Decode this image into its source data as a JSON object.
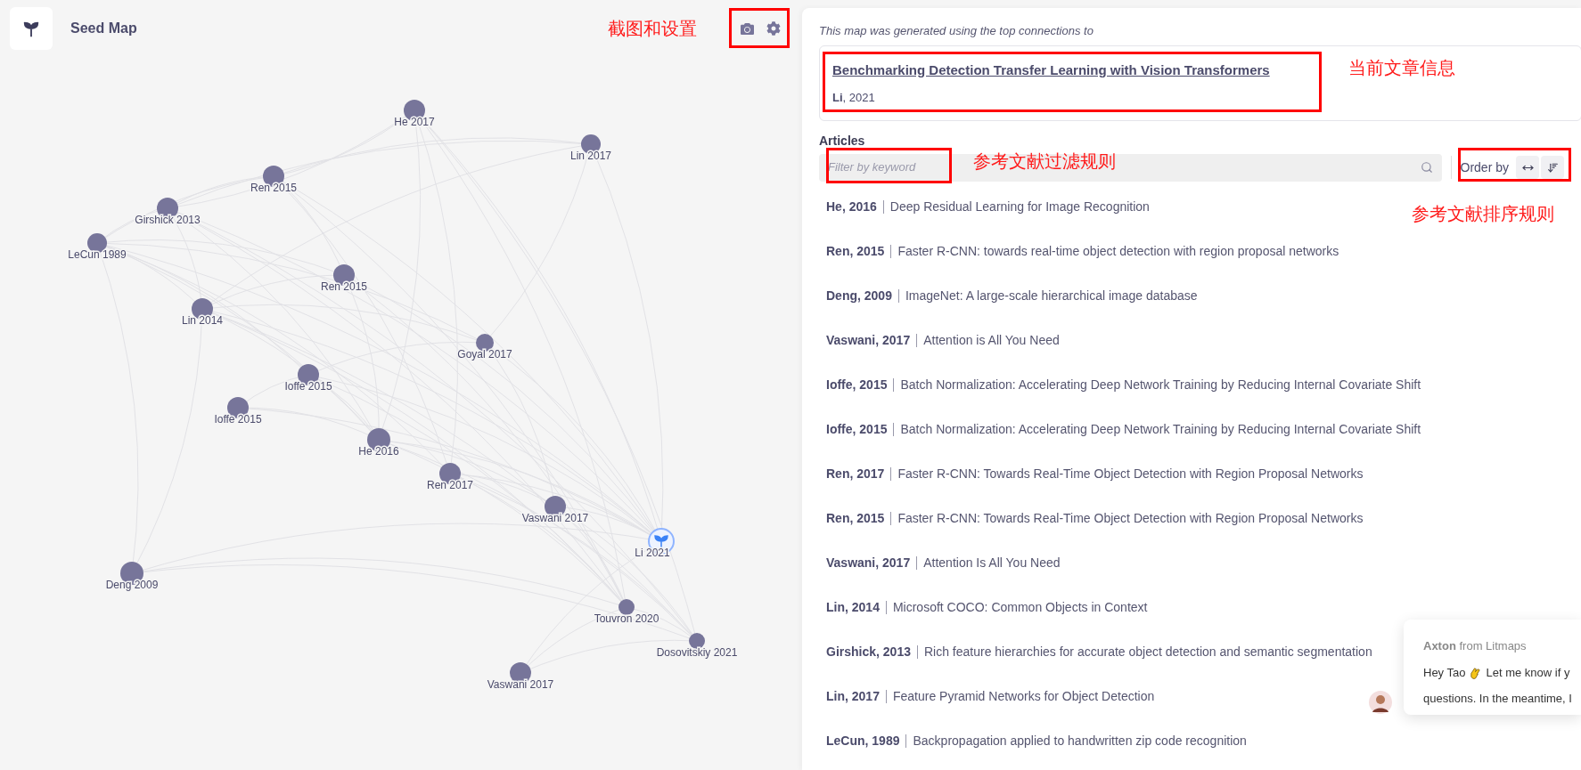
{
  "header": {
    "title": "Seed Map"
  },
  "map": {
    "nodes": [
      {
        "label": "He 2017",
        "kind": "paper"
      },
      {
        "label": "Lin 2017",
        "kind": "paper"
      },
      {
        "label": "Ren 2015",
        "kind": "paper"
      },
      {
        "label": "Girshick 2013",
        "kind": "paper"
      },
      {
        "label": "LeCun 1989",
        "kind": "paper"
      },
      {
        "label": "Ren 2015",
        "kind": "paper"
      },
      {
        "label": "Lin 2014",
        "kind": "paper"
      },
      {
        "label": "Goyal 2017",
        "kind": "paper"
      },
      {
        "label": "Ioffe 2015",
        "kind": "paper"
      },
      {
        "label": "Ioffe 2015",
        "kind": "paper"
      },
      {
        "label": "He 2016",
        "kind": "paper"
      },
      {
        "label": "Ren 2017",
        "kind": "paper"
      },
      {
        "label": "Vaswani 2017",
        "kind": "paper"
      },
      {
        "label": "Li 2021",
        "kind": "seed"
      },
      {
        "label": "Deng 2009",
        "kind": "paper"
      },
      {
        "label": "Touvron 2020",
        "kind": "paper"
      },
      {
        "label": "Dosovitskiy 2021",
        "kind": "paper"
      },
      {
        "label": "Vaswani 2017",
        "kind": "paper"
      }
    ]
  },
  "annotations": [
    {
      "text": "截图和设置"
    },
    {
      "text": "当前文章信息"
    },
    {
      "text": "参考文献过滤规则"
    },
    {
      "text": "参考文献排序规则"
    }
  ],
  "source": {
    "note": "This map was generated using the top connections to",
    "title": "Benchmarking Detection Transfer Learning with Vision Transformers",
    "byline": "**Li**, 2021"
  },
  "articles": {
    "heading": "Articles",
    "filter": {
      "placeholder": "Filter by keyword"
    },
    "order_label": "Order by",
    "items": [
      {
        "author": "He, 2016",
        "title": "Deep Residual Learning for Image Recognition"
      },
      {
        "author": "Ren, 2015",
        "title": "Faster R-CNN: towards real-time object detection with region proposal networks"
      },
      {
        "author": "Deng, 2009",
        "title": "ImageNet: A large-scale hierarchical image database"
      },
      {
        "author": "Vaswani, 2017",
        "title": "Attention is All You Need"
      },
      {
        "author": "Ioffe, 2015",
        "title": "Batch Normalization: Accelerating Deep Network Training by Reducing Internal Covariate Shift"
      },
      {
        "author": "Ioffe, 2015",
        "title": "Batch Normalization: Accelerating Deep Network Training by Reducing Internal Covariate Shift"
      },
      {
        "author": "Ren, 2017",
        "title": "Faster R-CNN: Towards Real-Time Object Detection with Region Proposal Networks"
      },
      {
        "author": "Ren, 2015",
        "title": "Faster R-CNN: Towards Real-Time Object Detection with Region Proposal Networks"
      },
      {
        "author": "Vaswani, 2017",
        "title": "Attention Is All You Need"
      },
      {
        "author": "Lin, 2014",
        "title": "Microsoft COCO: Common Objects in Context"
      },
      {
        "author": "Girshick, 2013",
        "title": "Rich feature hierarchies for accurate object detection and semantic segmentation"
      },
      {
        "author": "Lin, 2017",
        "title": "Feature Pyramid Networks for Object Detection"
      },
      {
        "author": "LeCun, 1989",
        "title": "Backpropagation applied to handwritten zip code recognition"
      }
    ]
  },
  "chat": {
    "sender": "Axton",
    "sender_suffix": "from Litmaps",
    "greeting": "Hey Tao",
    "line_1": "Let me know if y",
    "line_2": "questions. In the meantime, I"
  }
}
